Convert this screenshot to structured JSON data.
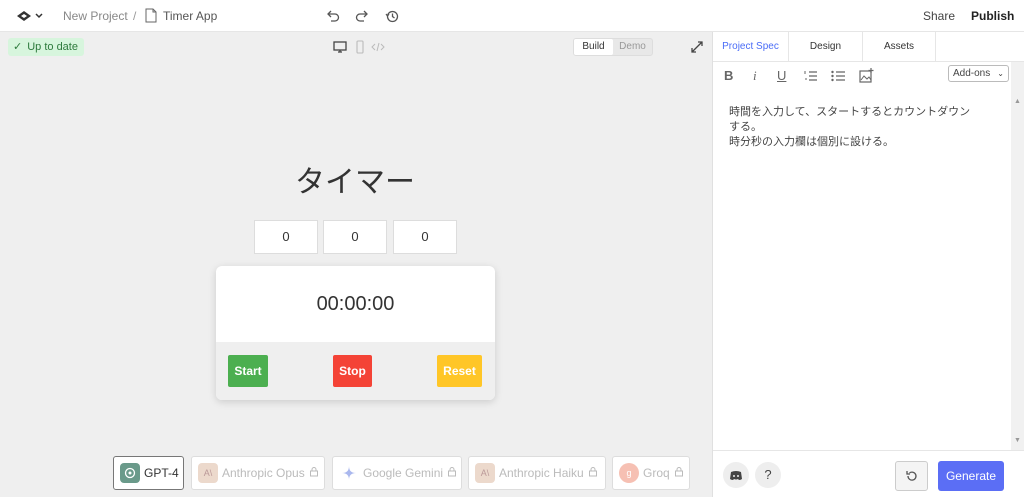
{
  "topbar": {
    "project": "New Project",
    "separator": "/",
    "file": "Timer App",
    "share": "Share",
    "publish": "Publish"
  },
  "preview": {
    "status": "Up to date",
    "modes": [
      "Build",
      "Demo"
    ],
    "active_mode": "Build"
  },
  "app": {
    "title": "タイマー",
    "inputs": [
      "0",
      "0",
      "0"
    ],
    "display": "00:00:00",
    "buttons": [
      {
        "label": "Start",
        "color": "#4caf50"
      },
      {
        "label": "Stop",
        "color": "#f44336"
      },
      {
        "label": "Reset",
        "color": "#ffc627"
      }
    ]
  },
  "models": [
    {
      "label": "GPT-4",
      "active": true
    },
    {
      "label": "Anthropic Opus",
      "active": false
    },
    {
      "label": "Google Gemini",
      "active": false
    },
    {
      "label": "Anthropic Haiku",
      "active": false
    },
    {
      "label": "Groq",
      "active": false
    }
  ],
  "panel": {
    "tabs": [
      "Project Spec",
      "Design",
      "Assets"
    ],
    "active_tab": "Project Spec",
    "addons": "Add-ons",
    "spec_lines": [
      "時間を入力して、スタートするとカウントダウン",
      "する。",
      "時分秒の入力欄は個別に設ける。"
    ],
    "generate": "Generate",
    "help": "?"
  },
  "colors": {
    "accent": "#5b6ef5",
    "status_bg": "#d7f5dd"
  }
}
